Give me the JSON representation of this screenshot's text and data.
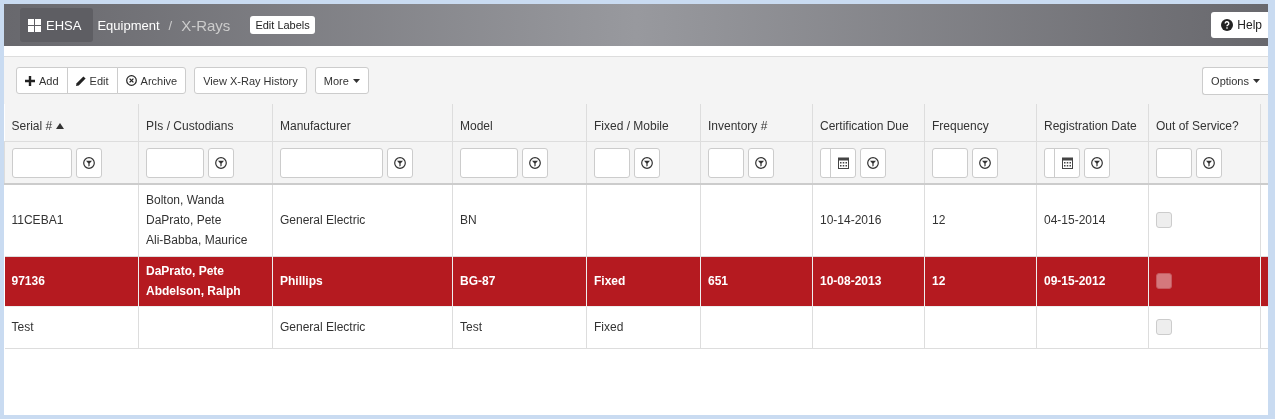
{
  "header": {
    "brand": "EHSA",
    "breadcrumb": [
      "Equipment",
      "X-Rays"
    ],
    "breadcrumb_separator": "/",
    "edit_labels": "Edit Labels",
    "help": "Help"
  },
  "toolbar": {
    "group": [
      {
        "kind": "add",
        "label": "Add"
      },
      {
        "kind": "edit",
        "label": "Edit"
      },
      {
        "kind": "archive",
        "label": "Archive"
      }
    ],
    "history": "View X-Ray History",
    "more": "More",
    "options": "Options"
  },
  "table": {
    "columns": [
      {
        "label": "Serial #",
        "sorted": true,
        "kind": "text"
      },
      {
        "label": "PIs / Custodians",
        "sorted": false,
        "kind": "text"
      },
      {
        "label": "Manufacturer",
        "sorted": false,
        "kind": "text"
      },
      {
        "label": "Model",
        "sorted": false,
        "kind": "text"
      },
      {
        "label": "Fixed / Mobile",
        "sorted": false,
        "kind": "text"
      },
      {
        "label": "Inventory #",
        "sorted": false,
        "kind": "text"
      },
      {
        "label": "Certification Due",
        "sorted": false,
        "kind": "date"
      },
      {
        "label": "Frequency",
        "sorted": false,
        "kind": "text"
      },
      {
        "label": "Registration Date",
        "sorted": false,
        "kind": "date"
      },
      {
        "label": "Out of Service?",
        "sorted": false,
        "kind": "text"
      }
    ],
    "rows": [
      {
        "selected": false,
        "serial": "11CEBA1",
        "custodians": [
          "Bolton, Wanda",
          "DaPrato, Pete",
          "Ali-Babba, Maurice"
        ],
        "manufacturer": "General Electric",
        "model": "BN",
        "certification_due": "10-14-2016",
        "frequency": "12",
        "registration_date": "04-15-2014",
        "out_of_service": false
      },
      {
        "selected": true,
        "serial": "97136",
        "custodians": [
          "DaPrato, Pete",
          "Abdelson, Ralph"
        ],
        "manufacturer": "Phillips",
        "model": "BG-87",
        "fixed_mobile": "Fixed",
        "inventory": "651",
        "certification_due": "10-08-2013",
        "frequency": "12",
        "registration_date": "09-15-2012",
        "out_of_service": false
      },
      {
        "selected": false,
        "serial": "Test",
        "manufacturer": "General Electric",
        "model": "Test",
        "fixed_mobile": "Fixed",
        "out_of_service": false
      }
    ]
  }
}
